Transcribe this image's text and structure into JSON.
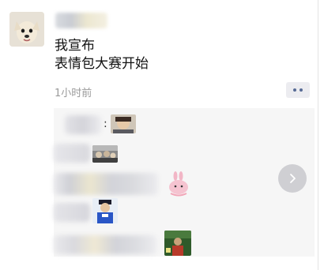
{
  "post": {
    "text_line1": "我宣布",
    "text_line2": "表情包大赛开始",
    "time": "1小时前"
  },
  "comments": [
    {
      "separator": ":",
      "sticker": "drama-face-sticker"
    },
    {
      "separator": "",
      "sticker": "crowd-photo-sticker"
    },
    {
      "separator": "",
      "sticker": "pink-rabbit-sticker"
    },
    {
      "separator": "",
      "sticker": "blue-shirt-person-sticker"
    },
    {
      "separator": "",
      "sticker": "green-scene-sticker"
    }
  ],
  "icons": {
    "more": "more-dots-icon",
    "next": "chevron-right-icon"
  },
  "colors": {
    "link_blue": "#576b95",
    "comment_bg": "#f6f6f6",
    "time_gray": "#9a9a9a"
  }
}
